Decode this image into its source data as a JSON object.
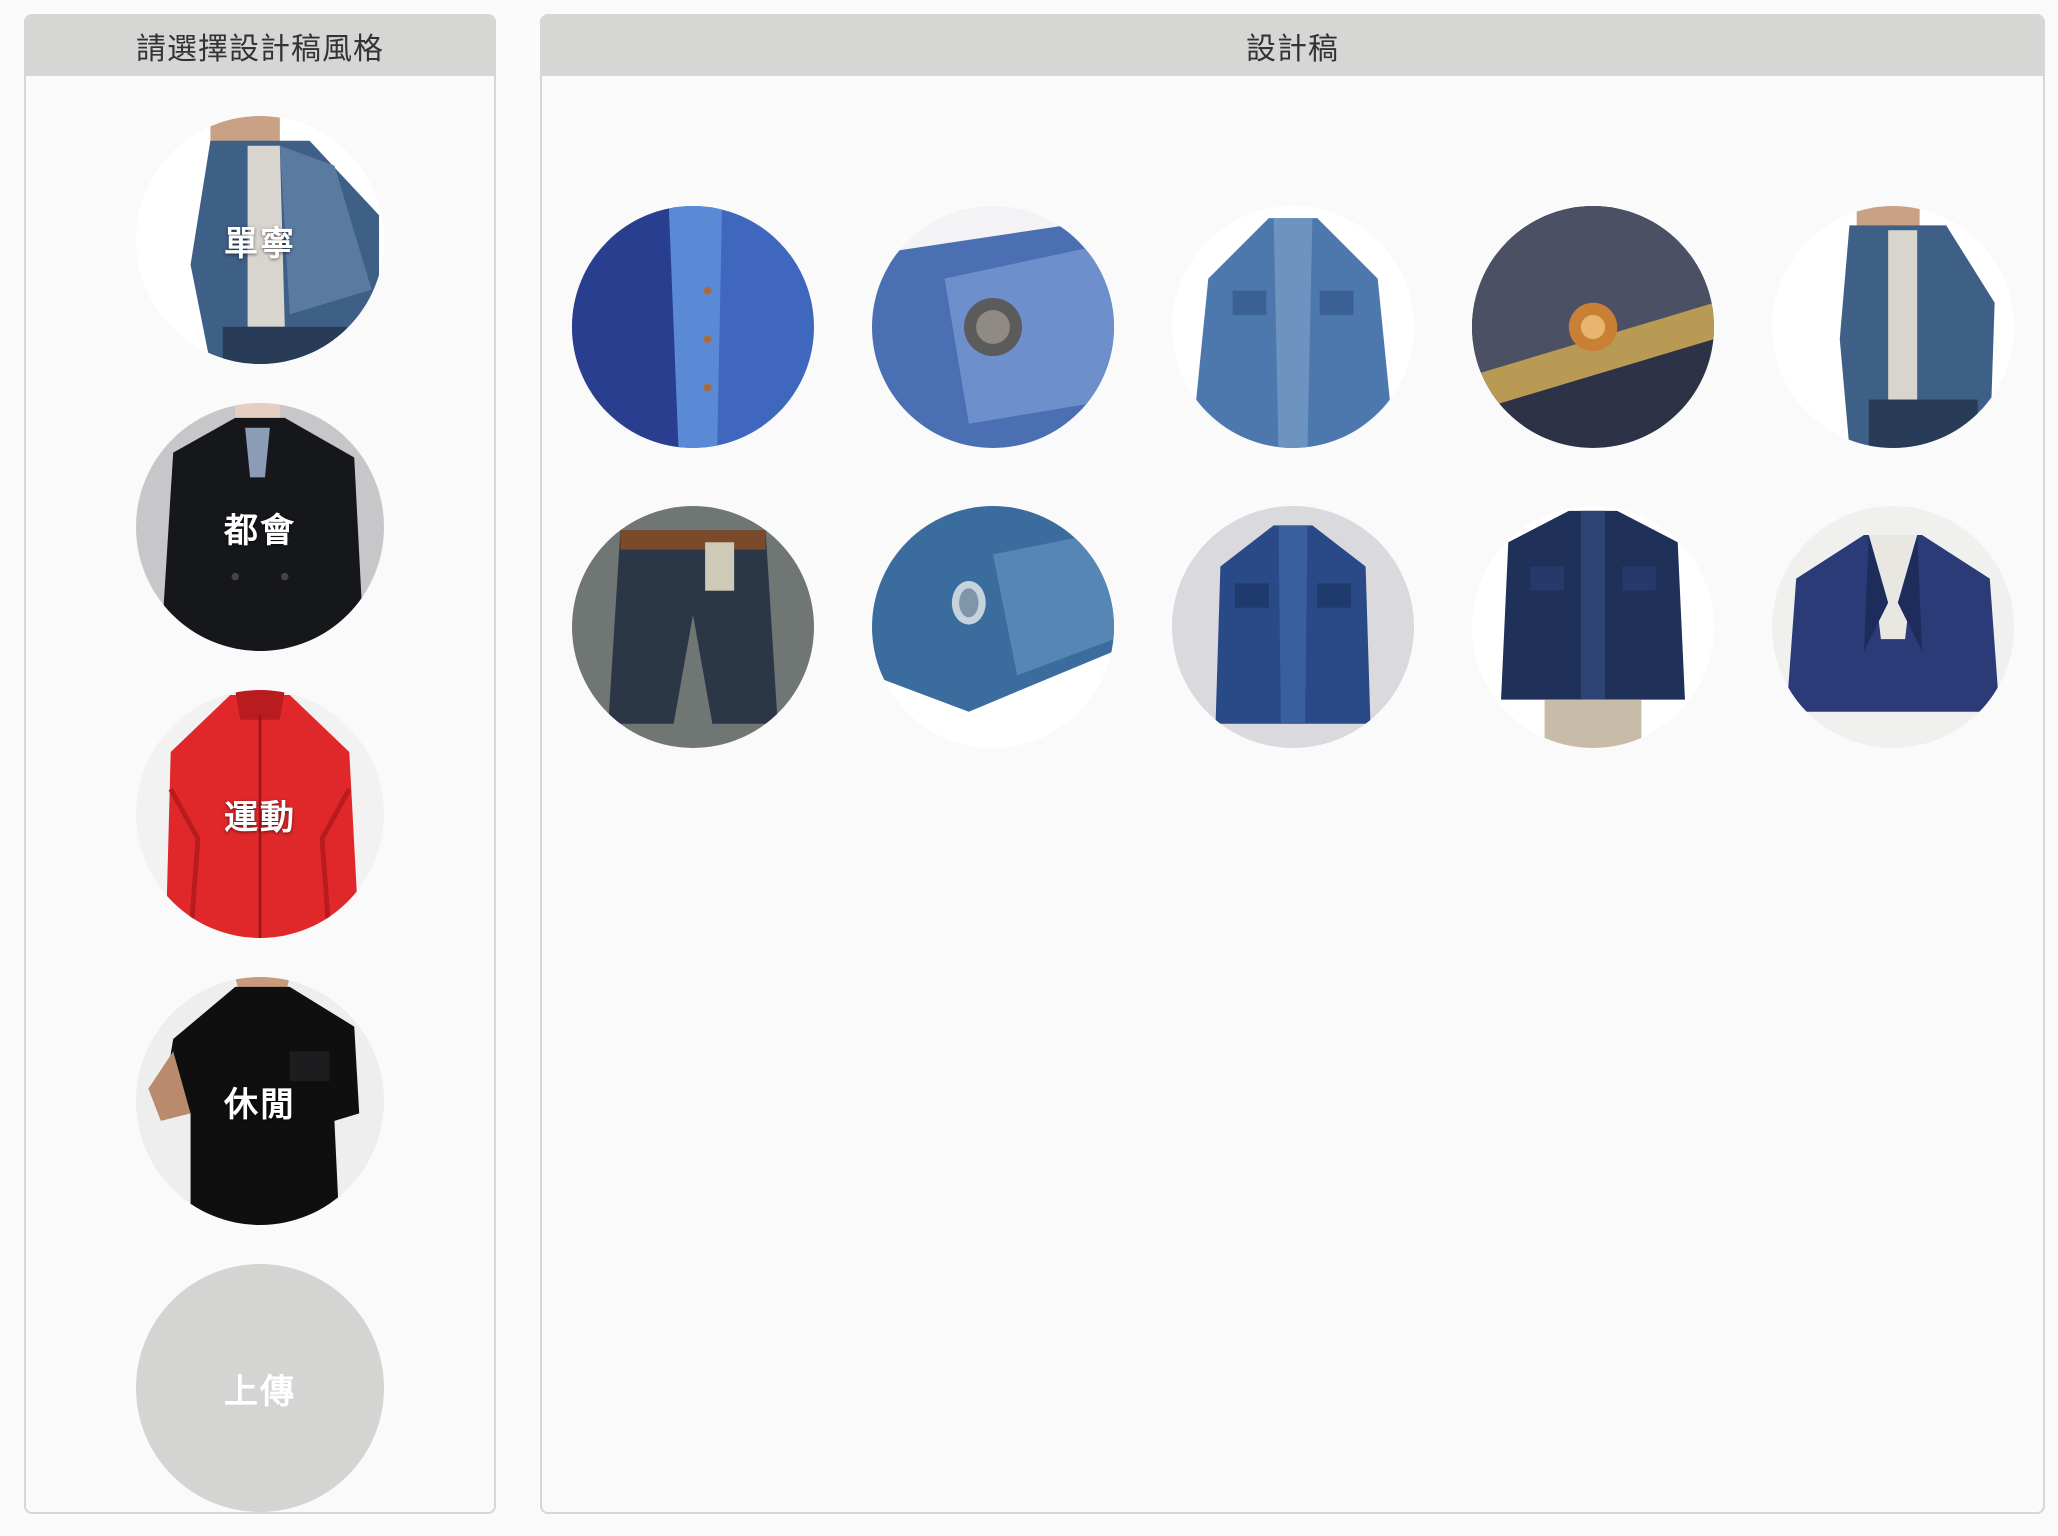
{
  "left_panel": {
    "title": "請選擇設計稿風格",
    "styles": [
      {
        "label": "單寧",
        "icon": "denim-jacket-photo"
      },
      {
        "label": "都會",
        "icon": "black-peacoat-photo"
      },
      {
        "label": "運動",
        "icon": "red-windbreaker-photo"
      },
      {
        "label": "休閒",
        "icon": "black-shirt-photo"
      },
      {
        "label": "上傳",
        "icon": "upload-placeholder"
      }
    ]
  },
  "right_panel": {
    "title": "設計稿",
    "designs": [
      {
        "icon": "blue-shirt-closeup"
      },
      {
        "icon": "denim-rivet-closeup"
      },
      {
        "icon": "denim-shirt"
      },
      {
        "icon": "denim-pocket-button"
      },
      {
        "icon": "denim-jacket-model"
      },
      {
        "icon": "denim-shorts"
      },
      {
        "icon": "denim-cuff-snap"
      },
      {
        "icon": "denim-shirt-folded"
      },
      {
        "icon": "dark-denim-jacket-model"
      },
      {
        "icon": "navy-blazer"
      }
    ]
  },
  "colors": {
    "header_bg": "#d6d6d4",
    "panel_bg": "#fafafa",
    "border": "#d6d6d4",
    "upload_bg": "#d4d4d2"
  }
}
